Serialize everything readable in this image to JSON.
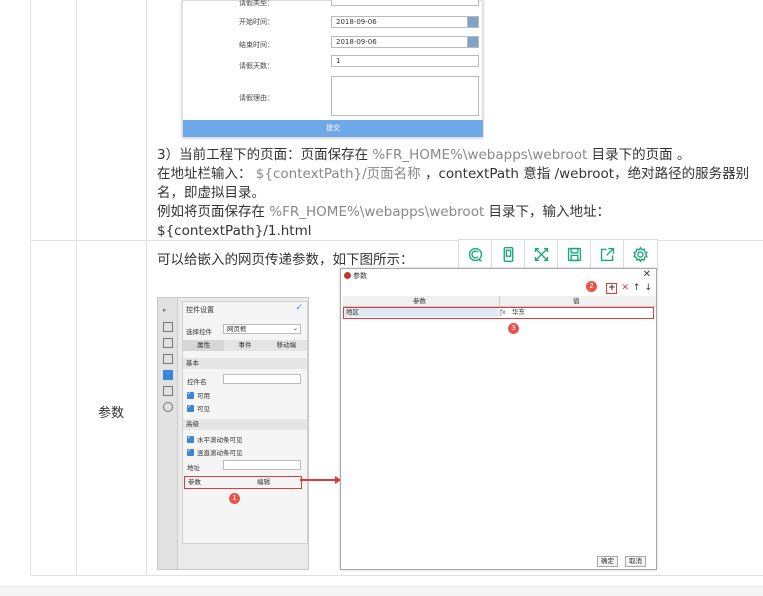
{
  "form": {
    "leave_type_label": "请假类型：",
    "start_label": "开始时间：",
    "start_value": "2018-09-06",
    "end_label": "结束时间：",
    "end_value": "2018-09-06",
    "days_label": "请假天数：",
    "days_value": "1",
    "reason_label": "请假理由：",
    "submit_label": "提交"
  },
  "doc": {
    "line1_a": "3）当前工程下的页面：页面保存在 ",
    "line1_code": "%FR_HOME%\\webapps\\webroot",
    "line1_b": " 目录下的页面 。",
    "line2_a": "在地址栏输入： ",
    "line2_code": "${contextPath}/页面名称",
    "line2_b": " ，contextPath 意指 /webroot，绝对路径的服务器别名，即虚拟目录。",
    "line3_a": "例如将页面保存在 ",
    "line3_code": "%FR_HOME%\\webapps\\webroot",
    "line3_b": " 目录下，输入地址：${contextPath}/1.html",
    "param_label": "参数",
    "param_text": "可以给嵌入的网页传递参数，如下图所示："
  },
  "toolbar": {
    "icons": [
      "copy-c-icon",
      "mobile-icon",
      "expand-icon",
      "save-icon",
      "share-icon",
      "settings-icon"
    ]
  },
  "designer": {
    "title": "控件设置",
    "select_widget_label": "选择控件",
    "select_widget_value": "网页框",
    "tabs": [
      "属性",
      "事件",
      "移动端"
    ],
    "basic_section": "基本",
    "widget_name_label": "控件名",
    "cb_usable": "可用",
    "cb_visible": "可见",
    "advanced_section": "高级",
    "cb_hscroll": "水平滚动条可见",
    "cb_vscroll": "竖直滚动条可见",
    "address_label": "地址",
    "param_key": "参数",
    "param_value": "编辑"
  },
  "dialog": {
    "title": "参数",
    "col_param": "参数",
    "col_value": "值",
    "row_key": "地区",
    "row_value": "华东",
    "ok_label": "确定",
    "cancel_label": "取消"
  },
  "badges": [
    "1",
    "2",
    "3"
  ],
  "colors": {
    "accent_green": "#19a67e",
    "highlight_red": "#e03a3a",
    "badge_red": "#e8534a",
    "submit_blue": "#6fa8e8"
  }
}
